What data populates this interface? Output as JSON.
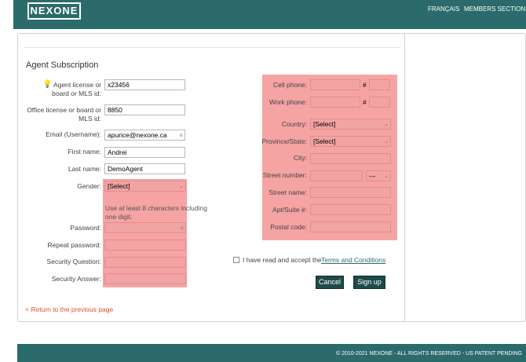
{
  "header": {
    "logo": "NEXONE",
    "nav": [
      "FRANÇAIS",
      "MEMBERS SECTION"
    ]
  },
  "form": {
    "title": "Agent Subscription",
    "left": {
      "agent_license_label_1": "Agent license or",
      "agent_license_label_2": "board or MLS id:",
      "agent_license_value": "x23456",
      "office_license_label_1": "Office license or board or",
      "office_license_label_2": "MLS id:",
      "office_license_value": "8850",
      "email_label": "Email (Username):",
      "email_value": "apurice@nexone.ca",
      "first_name_label": "First name:",
      "first_name_value": "Andrei",
      "last_name_label": "Last name:",
      "last_name_value": "DemoAgent",
      "gender_label": "Gender:",
      "gender_value": "[Select]",
      "password_hint": "Use at least 8 characters including one digit.",
      "password_label": "Password:",
      "repeat_password_label": "Repeat password:",
      "security_question_label": "Security Question:",
      "security_answer_label": "Security Answer:"
    },
    "right": {
      "cell_phone_label": "Cell phone:",
      "work_phone_label": "Work phone:",
      "hash": "#",
      "country_label": "Country:",
      "country_value": "[Select]",
      "province_label": "Province/State:",
      "province_value": "[Select]",
      "city_label": "City:",
      "street_number_label": "Street number:",
      "street_suffix_value": "---",
      "street_name_label": "Street name:",
      "apt_label": "Apt/Suite #:",
      "postal_code_label": "Postal code:"
    },
    "terms_text": "I have read and accept the",
    "terms_link": "Terms and Conditions",
    "cancel_label": "Cancel",
    "signup_label": "Sign up",
    "return_link": "< Return to the previous page"
  },
  "footer": {
    "copyright": "© 2010-2021 NEXONE - ALL RIGHTS RESERVED - US PATENT PENDING"
  },
  "colors": {
    "brand": "#2c6b6b",
    "error_highlight": "#f5a3a3",
    "link": "#e0502a",
    "button": "#1f4a4a"
  }
}
